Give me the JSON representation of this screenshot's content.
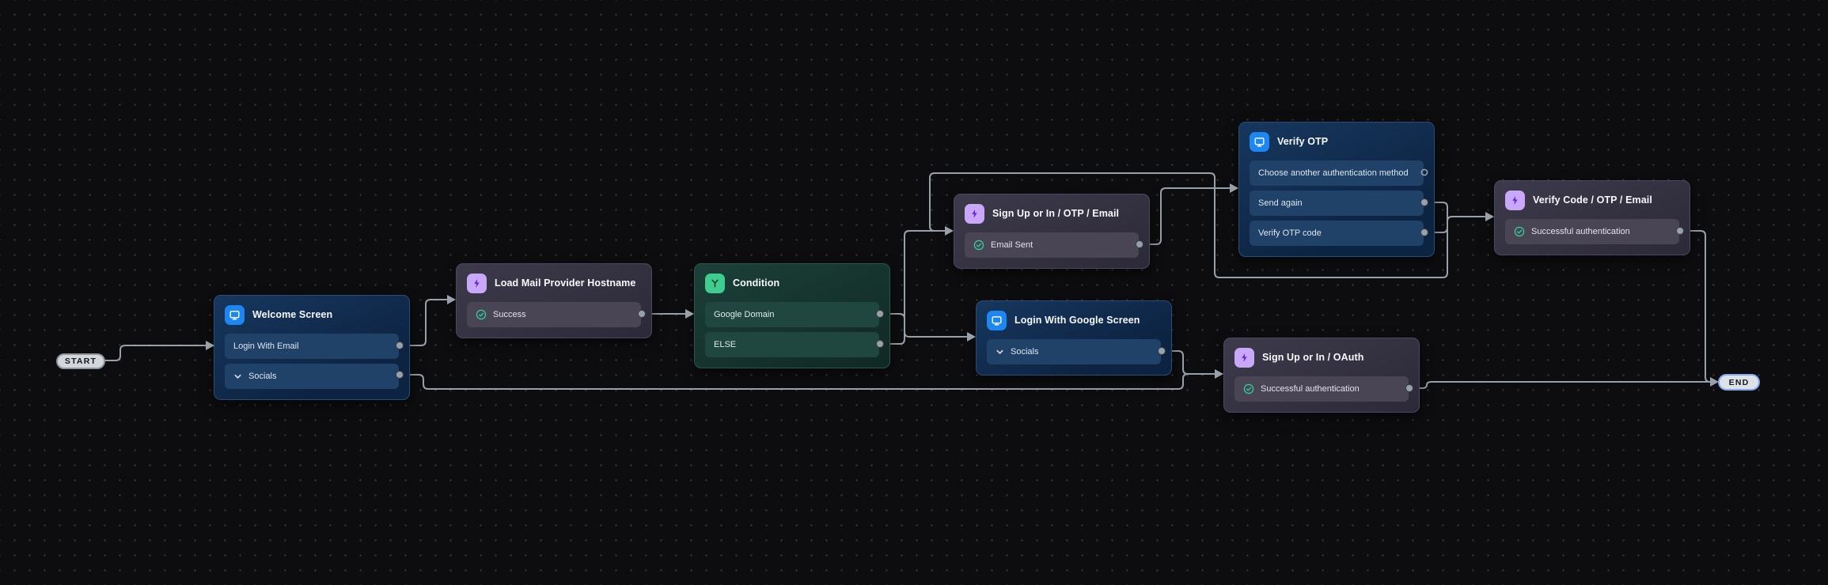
{
  "flow": {
    "start": {
      "label": "START"
    },
    "end": {
      "label": "END"
    },
    "nodes": [
      {
        "id": "welcome-screen",
        "type": "screen",
        "title": "Welcome Screen",
        "rows": [
          {
            "label": "Login With Email"
          },
          {
            "label": "Socials",
            "icon": "chevron-down"
          }
        ]
      },
      {
        "id": "load-mail-provider-hostname",
        "type": "action",
        "title": "Load Mail Provider Hostname",
        "rows": [
          {
            "label": "Success",
            "icon": "check-circle"
          }
        ]
      },
      {
        "id": "condition",
        "type": "condition",
        "title": "Condition",
        "rows": [
          {
            "label": "Google Domain"
          },
          {
            "label": "ELSE"
          }
        ]
      },
      {
        "id": "sign-up-or-in-otp-email",
        "type": "action",
        "title": "Sign Up or In / OTP / Email",
        "rows": [
          {
            "label": "Email Sent",
            "icon": "check-circle"
          }
        ]
      },
      {
        "id": "login-with-google-screen",
        "type": "screen",
        "title": "Login With Google Screen",
        "rows": [
          {
            "label": "Socials",
            "icon": "chevron-down"
          }
        ]
      },
      {
        "id": "verify-otp",
        "type": "screen",
        "title": "Verify OTP",
        "rows": [
          {
            "label": "Choose another authentication method"
          },
          {
            "label": "Send again"
          },
          {
            "label": "Verify OTP code"
          }
        ]
      },
      {
        "id": "sign-up-or-in-oauth",
        "type": "action",
        "title": "Sign Up or In / OAuth",
        "rows": [
          {
            "label": "Successful authentication",
            "icon": "check-circle"
          }
        ]
      },
      {
        "id": "verify-code-otp-email",
        "type": "action",
        "title": "Verify Code / OTP / Email",
        "rows": [
          {
            "label": "Successful authentication",
            "icon": "check-circle"
          }
        ]
      }
    ],
    "colors": {
      "canvas_bg": "#0d0d0f",
      "edge": "#98a0aa",
      "screen_icon_bg": "#1e86f0",
      "action_icon_bg": "#c9a8f9",
      "action_bolt": "#6d28d9",
      "condition_icon_bg": "#3ecd8e",
      "success_check": "#34d399"
    }
  }
}
